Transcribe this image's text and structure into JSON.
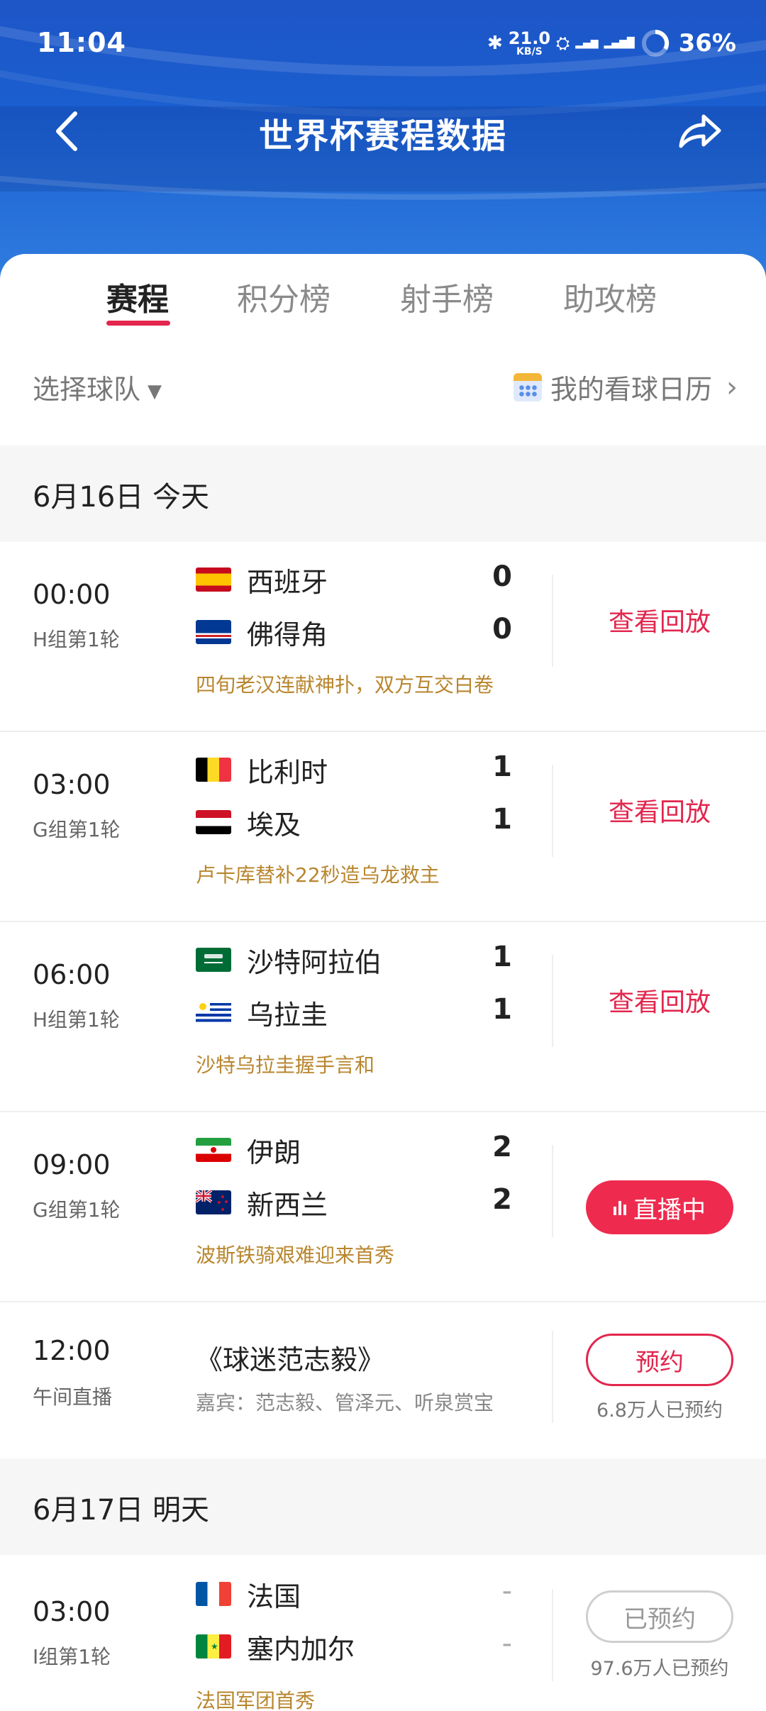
{
  "status_bar": {
    "time": "11:04",
    "speed_value": "21.0",
    "speed_unit": "KB/S",
    "battery": "36%"
  },
  "nav": {
    "title": "世界杯赛程数据"
  },
  "tabs": [
    "赛程",
    "积分榜",
    "射手榜",
    "助攻榜"
  ],
  "filter": {
    "team_select": "选择球队",
    "calendar_link": "我的看球日历"
  },
  "days": [
    {
      "label": "6月16日 今天"
    },
    {
      "label": "6月17日 明天"
    }
  ],
  "matches": [
    {
      "time": "00:00",
      "group": "H组第1轮",
      "home": "西班牙",
      "away": "佛得角",
      "home_score": "0",
      "away_score": "0",
      "desc": "四旬老汉连献神扑，双方互交白卷",
      "action": "查看回放"
    },
    {
      "time": "03:00",
      "group": "G组第1轮",
      "home": "比利时",
      "away": "埃及",
      "home_score": "1",
      "away_score": "1",
      "desc": "卢卡库替补22秒造乌龙救主",
      "action": "查看回放"
    },
    {
      "time": "06:00",
      "group": "H组第1轮",
      "home": "沙特阿拉伯",
      "away": "乌拉圭",
      "home_score": "1",
      "away_score": "1",
      "desc": "沙特乌拉圭握手言和",
      "action": "查看回放"
    },
    {
      "time": "09:00",
      "group": "G组第1轮",
      "home": "伊朗",
      "away": "新西兰",
      "home_score": "2",
      "away_score": "2",
      "desc": "波斯铁骑艰难迎来首秀",
      "action": "直播中"
    }
  ],
  "show": {
    "time": "12:00",
    "type": "午间直播",
    "title": "《球迷范志毅》",
    "guests": "嘉宾：范志毅、管泽元、听泉赏宝",
    "action": "预约",
    "count": "6.8万人已预约"
  },
  "next_match": {
    "time": "03:00",
    "group": "I组第1轮",
    "home": "法国",
    "away": "塞内加尔",
    "home_score": "-",
    "away_score": "-",
    "desc": "法国军团首秀",
    "action": "已预约",
    "count": "97.6万人已预约"
  }
}
